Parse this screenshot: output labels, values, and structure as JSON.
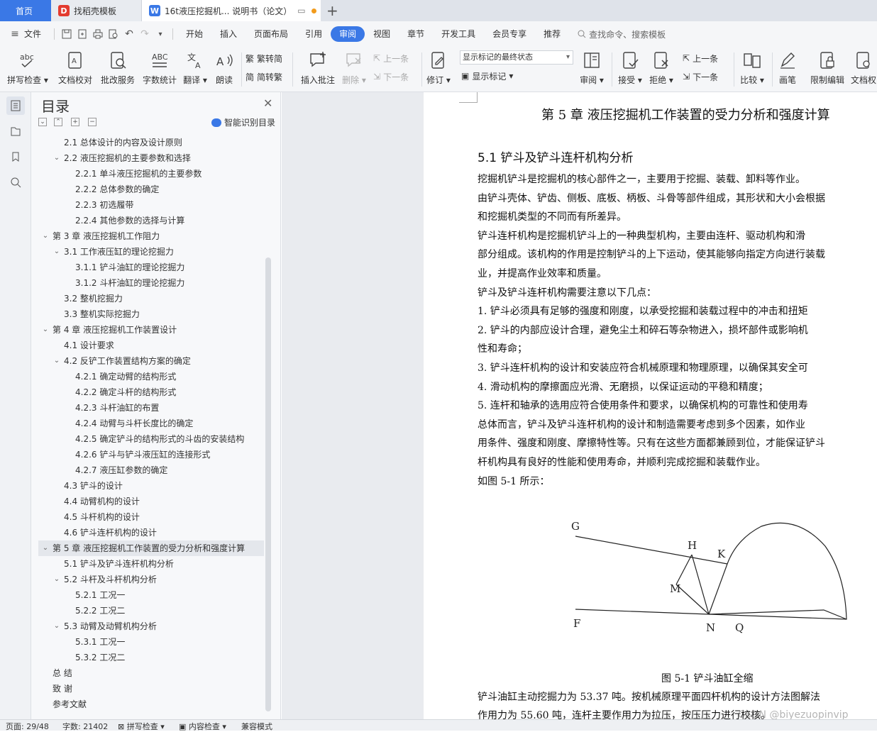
{
  "tabs": [
    {
      "label": "首页"
    },
    {
      "label": "找稻壳模板"
    },
    {
      "label": "16t液压挖掘机... 说明书（论文）"
    }
  ],
  "menu": {
    "file": "文件",
    "items": [
      "开始",
      "插入",
      "页面布局",
      "引用",
      "审阅",
      "视图",
      "章节",
      "开发工具",
      "会员专享",
      "推荐"
    ],
    "active": "审阅",
    "search": "查找命令、搜索模板"
  },
  "ribbon": {
    "spell_check": "拼写检查",
    "doc_proof": "文档校对",
    "batch_service": "批改服务",
    "word_count": "字数统计",
    "translate": "翻译",
    "read_aloud": "朗读",
    "trad_to_simp": "繁转简",
    "simp_to_trad": "简转繁",
    "insert_comment": "插入批注",
    "delete": "删除",
    "prev": "上一条",
    "next": "下一条",
    "track_changes": "修订",
    "markup_state": "显示标记的最终状态",
    "show_markup": "显示标记",
    "review": "审阅",
    "accept": "接受",
    "reject": "拒绝",
    "prev2": "上一条",
    "next2": "下一条",
    "compare": "比较",
    "pen": "画笔",
    "restrict_edit": "限制编辑",
    "doc_perm": "文档权"
  },
  "toc": {
    "title": "目录",
    "smart": "智能识别目录",
    "items": [
      {
        "label": "2.1  总体设计的内容及设计原则",
        "level": 2,
        "chev": false
      },
      {
        "label": "2.2  液压挖掘机的主要参数和选择",
        "level": 2,
        "chev": true
      },
      {
        "label": "2.2.1  单斗液压挖掘机的主要参数",
        "level": 3,
        "chev": false
      },
      {
        "label": "2.2.2  总体参数的确定",
        "level": 3,
        "chev": false
      },
      {
        "label": "2.2.3 初选履带",
        "level": 3,
        "chev": false
      },
      {
        "label": "2.2.4 其他参数的选择与计算",
        "level": 3,
        "chev": false
      },
      {
        "label": "第 3 章  液压挖掘机工作阻力",
        "level": 1,
        "chev": true
      },
      {
        "label": "3.1  工作液压缸的理论挖掘力",
        "level": 2,
        "chev": true
      },
      {
        "label": "3.1.1 铲斗油缸的理论挖掘力",
        "level": 3,
        "chev": false
      },
      {
        "label": "3.1.2  斗杆油缸的理论挖掘力",
        "level": 3,
        "chev": false
      },
      {
        "label": "3.2  整机挖掘力",
        "level": 2,
        "chev": false
      },
      {
        "label": "3.3  整机实际挖掘力",
        "level": 2,
        "chev": false
      },
      {
        "label": "第 4 章  液压挖掘机工作装置设计",
        "level": 1,
        "chev": true
      },
      {
        "label": "4.1 设计要求",
        "level": 2,
        "chev": false
      },
      {
        "label": "4.2 反铲工作装置结构方案的确定",
        "level": 2,
        "chev": true
      },
      {
        "label": "4.2.1 确定动臂的结构形式",
        "level": 3,
        "chev": false
      },
      {
        "label": "4.2.2 确定斗杆的结构形式",
        "level": 3,
        "chev": false
      },
      {
        "label": "4.2.3 斗杆油缸的布置",
        "level": 3,
        "chev": false
      },
      {
        "label": "4.2.4 动臂与斗杆长度比的确定",
        "level": 3,
        "chev": false
      },
      {
        "label": "4.2.5 确定铲斗的结构形式的斗齿的安装结构",
        "level": 3,
        "chev": false
      },
      {
        "label": "4.2.6 铲斗与铲斗液压缸的连接形式",
        "level": 3,
        "chev": false
      },
      {
        "label": "4.2.7 液压缸参数的确定",
        "level": 3,
        "chev": false
      },
      {
        "label": "4.3  铲斗的设计",
        "level": 2,
        "chev": false
      },
      {
        "label": "4.4 动臂机构的设计",
        "level": 2,
        "chev": false
      },
      {
        "label": "4.5 斗杆机构的设计",
        "level": 2,
        "chev": false
      },
      {
        "label": "4.6  铲斗连杆机构的设计",
        "level": 2,
        "chev": false
      },
      {
        "label": "第 5 章  液压挖掘机工作装置的受力分析和强度计算",
        "level": 1,
        "chev": true,
        "selected": true
      },
      {
        "label": "5.1 铲斗及铲斗连杆机构分析",
        "level": 2,
        "chev": false
      },
      {
        "label": "5.2 斗杆及斗杆机构分析",
        "level": 2,
        "chev": true
      },
      {
        "label": "5.2.1 工况一",
        "level": 3,
        "chev": false
      },
      {
        "label": "5.2.2 工况二",
        "level": 3,
        "chev": false
      },
      {
        "label": "5.3 动臂及动臂机构分析",
        "level": 2,
        "chev": true
      },
      {
        "label": "5.3.1 工况一",
        "level": 3,
        "chev": false
      },
      {
        "label": "5.3.2 工况二",
        "level": 3,
        "chev": false
      },
      {
        "label": "总    结",
        "level": 1,
        "chev": false
      },
      {
        "label": "致    谢",
        "level": 1,
        "chev": false
      },
      {
        "label": "参考文献",
        "level": 1,
        "chev": false
      }
    ]
  },
  "doc": {
    "chapter_title": "第 5 章  液压挖掘机工作装置的受力分析和强度计算",
    "section_title": "5.1 铲斗及铲斗连杆机构分析",
    "lines": [
      "      挖掘机铲斗是挖掘机的核心部件之一，主要用于挖掘、装载、卸料等作业。",
      "由铲斗壳体、铲齿、侧板、底板、柄板、斗骨等部件组成，其形状和大小会根据",
      "和挖掘机类型的不同而有所差异。",
      "      铲斗连杆机构是挖掘机铲斗上的一种典型机构，主要由连杆、驱动机构和滑",
      "部分组成。该机构的作用是控制铲斗的上下运动，使其能够向指定方向进行装载",
      "业，并提高作业效率和质量。",
      "      铲斗及铲斗连杆机构需要注意以下几点：",
      "      1. 铲斗必须具有足够的强度和刚度，以承受挖掘和装载过程中的冲击和扭矩",
      "      2. 铲斗的内部应设计合理，避免尘土和碎石等杂物进入，损坏部件或影响机",
      "性和寿命；",
      "      3. 铲斗连杆机构的设计和安装应符合机械原理和物理原理，以确保其安全可",
      "      4. 滑动机构的摩擦面应光滑、无磨损，以保证运动的平稳和精度；",
      "      5. 连杆和轴承的选用应符合使用条件和要求，以确保机构的可靠性和使用寿",
      "      总体而言，铲斗及铲斗连杆机构的设计和制造需要考虑到多个因素，如作业",
      "用条件、强度和刚度、摩擦特性等。只有在这些方面都兼顾到位，才能保证铲斗",
      "杆机构具有良好的性能和使用寿命，并顺利完成挖掘和装载作业。",
      "      如图 5-1 所示："
    ],
    "figure_labels": {
      "G": "G",
      "H": "H",
      "K": "K",
      "M": "M",
      "F": "F",
      "N": "N",
      "Q": "Q"
    },
    "figure_caption": "图 5-1 铲斗油缸全缩",
    "after_lines": [
      "      铲斗油缸主动挖掘力为 53.37 吨。按机械原理平面四杆机构的设计方法图解法",
      "作用力为 55.60 吨，连杆主要作用力为拉压，按压压力进行校核。"
    ]
  },
  "status": {
    "page": "页面: 29/48",
    "words": "字数: 21402",
    "spell": "拼写检查",
    "content_check": "内容检查",
    "compat": "兼容模式"
  },
  "watermark": "CSDN @biyezuopinvip",
  "colors": {
    "accent": "#3a78e6",
    "tab_bg": "#dfe3ea",
    "ribbon_bg": "#f5f6f8"
  }
}
